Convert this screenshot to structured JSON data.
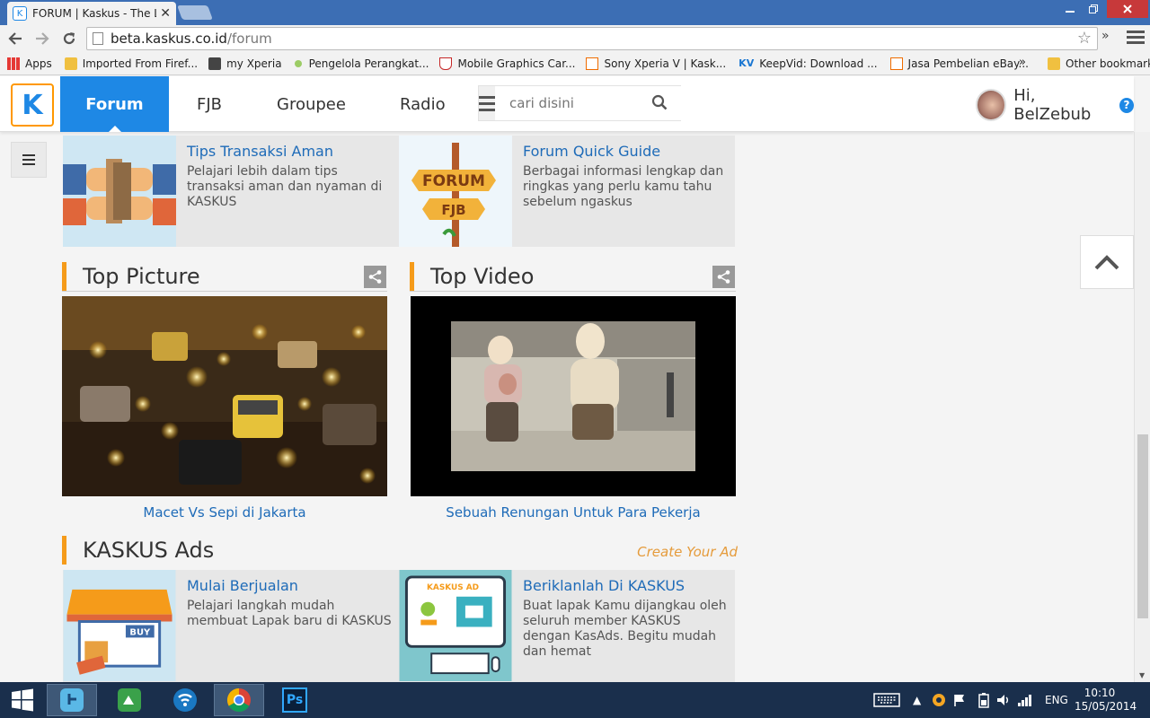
{
  "browser": {
    "tab_title": "FORUM | Kaskus - The Lar",
    "url_host": "beta.kaskus.co.id",
    "url_path": "/forum",
    "more_label": "»",
    "bookmarks": [
      {
        "label": "Apps",
        "icon": "apps-icon"
      },
      {
        "label": "Imported From Firef...",
        "icon": "folder-icon"
      },
      {
        "label": "my Xperia",
        "icon": "xperia-icon"
      },
      {
        "label": "Pengelola Perangkat...",
        "icon": "dot-icon"
      },
      {
        "label": "Mobile Graphics Car...",
        "icon": "shield-icon"
      },
      {
        "label": "Sony Xperia V | Kask...",
        "icon": "kaskus-icon"
      },
      {
        "label": "KeepVid: Download ...",
        "icon": "keepvid-icon"
      },
      {
        "label": "Jasa Pembelian eBay...",
        "icon": "kaskus-icon"
      }
    ],
    "bookmarks_more": "»",
    "other_bookmarks": "Other bookmarks",
    "kv_text": "KV"
  },
  "site": {
    "logo_text": "K",
    "nav": [
      {
        "label": "Forum"
      },
      {
        "label": "FJB"
      },
      {
        "label": "Groupee"
      },
      {
        "label": "Radio"
      }
    ],
    "search_placeholder": "cari disini",
    "greeting": "Hi, BelZebub",
    "help": "?"
  },
  "cards_top": [
    {
      "title": "Tips Transaksi Aman",
      "desc": "Pelajari lebih dalam tips transaksi aman dan nyaman di KASKUS"
    },
    {
      "title": "Forum Quick Guide",
      "desc": "Berbagai informasi lengkap dan ringkas yang perlu kamu tahu sebelum ngaskus",
      "sign1": "FORUM",
      "sign2": "FJB"
    }
  ],
  "top_picture": {
    "heading": "Top Picture",
    "caption": "Macet Vs Sepi di Jakarta"
  },
  "top_video": {
    "heading": "Top Video",
    "caption": "Sebuah Renungan Untuk Para Pekerja"
  },
  "ads": {
    "heading": "KASKUS Ads",
    "create_link": "Create Your Ad",
    "cards": [
      {
        "title": "Mulai Berjualan",
        "desc": "Pelajari langkah mudah membuat Lapak baru di KASKUS",
        "badge": "BUY"
      },
      {
        "title": "Beriklanlah Di KASKUS",
        "desc": "Buat lapak Kamu dijangkau oleh seluruh member KASKUS dengan KasAds. Begitu mudah dan hemat",
        "badge": "KASKUS AD"
      }
    ]
  },
  "taskbar": {
    "lang": "ENG",
    "time": "10:10",
    "date": "15/05/2014",
    "ps_label": "Ps"
  },
  "colors": {
    "accent": "#1e88e5",
    "section_bar": "#f59b1a",
    "link": "#1e6bb8"
  }
}
